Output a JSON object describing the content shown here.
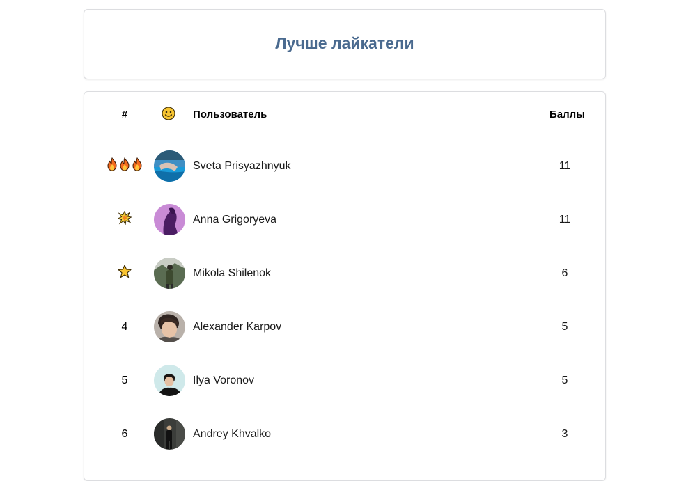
{
  "title": "Лучше лайкатели",
  "table": {
    "headers": {
      "rank": "#",
      "emoji_icon": "smiley-face-icon",
      "user": "Пользователь",
      "points": "Баллы"
    },
    "rows": [
      {
        "rank": "",
        "rank_icon": "fire-icon-x3",
        "name": "Sveta Prisyazhnyuk",
        "points": "11"
      },
      {
        "rank": "",
        "rank_icon": "collision-burst-icon",
        "name": "Anna Grigoryeva",
        "points": "11"
      },
      {
        "rank": "",
        "rank_icon": "star-icon",
        "name": "Mikola Shilenok",
        "points": "6"
      },
      {
        "rank": "4",
        "rank_icon": "",
        "name": "Alexander Karpov",
        "points": "5"
      },
      {
        "rank": "5",
        "rank_icon": "",
        "name": "Ilya Voronov",
        "points": "5"
      },
      {
        "rank": "6",
        "rank_icon": "",
        "name": "Andrey Khvalko",
        "points": "3"
      }
    ]
  },
  "colors": {
    "title": "#4a6a8f",
    "border": "#dcdde0",
    "divider": "#d4d4d4"
  }
}
